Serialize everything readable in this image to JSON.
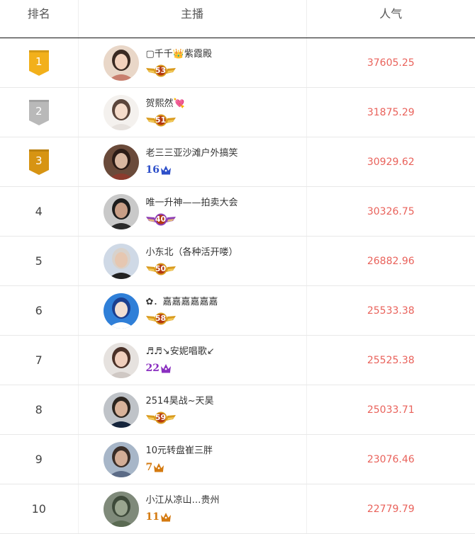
{
  "header": {
    "rank": "排名",
    "host": "主播",
    "popularity": "人气"
  },
  "rows": [
    {
      "rank": "1",
      "medal": "gold",
      "name": "▢千千👑紫霞殿",
      "badge": {
        "type": "wings",
        "level": "53"
      },
      "popularity": "37605.25",
      "avatar": "avatar-woman-light"
    },
    {
      "rank": "2",
      "medal": "silver",
      "name": "贺熙然💘",
      "badge": {
        "type": "wings",
        "level": "51"
      },
      "popularity": "31875.29",
      "avatar": "avatar-woman-white"
    },
    {
      "rank": "3",
      "medal": "bronze",
      "name": "老三三亚沙滩户外搞笑",
      "badge": {
        "type": "crown",
        "level": "16",
        "color": "#2d4fc9"
      },
      "popularity": "30929.62",
      "avatar": "avatar-mask"
    },
    {
      "rank": "4",
      "medal": "",
      "name": "唯一升神——拍卖大会",
      "badge": {
        "type": "wings-purple",
        "level": "40"
      },
      "popularity": "30326.75",
      "avatar": "avatar-man-dark"
    },
    {
      "rank": "5",
      "medal": "",
      "name": "小东北（各种活开喽）",
      "badge": {
        "type": "wings",
        "level": "50"
      },
      "popularity": "26882.96",
      "avatar": "avatar-man-suit"
    },
    {
      "rank": "6",
      "medal": "",
      "name": "✿．嘉嘉嘉嘉嘉嘉",
      "badge": {
        "type": "wings",
        "level": "58"
      },
      "popularity": "25533.38",
      "avatar": "avatar-blue-tower"
    },
    {
      "rank": "7",
      "medal": "",
      "name": "♬♬↘安妮唱歌↙",
      "badge": {
        "type": "crown",
        "level": "22",
        "color": "#8a2fc0"
      },
      "popularity": "25525.38",
      "avatar": "avatar-woman-short"
    },
    {
      "rank": "8",
      "medal": "",
      "name": "2514昊战~天昊",
      "badge": {
        "type": "wings",
        "level": "59"
      },
      "popularity": "25033.71",
      "avatar": "avatar-man-formal"
    },
    {
      "rank": "9",
      "medal": "",
      "name": "10元转盘崔三胖",
      "badge": {
        "type": "crown",
        "level": "7",
        "color": "#d47a10"
      },
      "popularity": "23076.46",
      "avatar": "avatar-man-glasses"
    },
    {
      "rank": "10",
      "medal": "",
      "name": "小江从凉山…贵州",
      "badge": {
        "type": "crown",
        "level": "11",
        "color": "#d47a10"
      },
      "popularity": "22779.79",
      "avatar": "avatar-landscape"
    }
  ],
  "colors": {
    "gold": "#f2b01b",
    "silver": "#b9b9b9",
    "bronze": "#d79413",
    "popularity_text": "#e9625b",
    "wings": "#d99a1d",
    "wings_purple": "#8f3fb5"
  }
}
